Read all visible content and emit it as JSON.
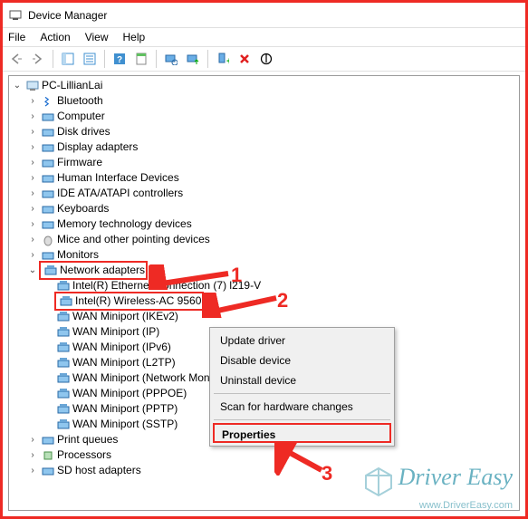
{
  "title": "Device Manager",
  "menu": {
    "file": "File",
    "action": "Action",
    "view": "View",
    "help": "Help"
  },
  "root": "PC-LillianLai",
  "nodes": [
    {
      "label": "Bluetooth",
      "icon": "bt"
    },
    {
      "label": "Computer",
      "icon": "pc"
    },
    {
      "label": "Disk drives",
      "icon": "disk"
    },
    {
      "label": "Display adapters",
      "icon": "disp"
    },
    {
      "label": "Firmware",
      "icon": "fw"
    },
    {
      "label": "Human Interface Devices",
      "icon": "hid"
    },
    {
      "label": "IDE ATA/ATAPI controllers",
      "icon": "ide"
    },
    {
      "label": "Keyboards",
      "icon": "kb"
    },
    {
      "label": "Memory technology devices",
      "icon": "mem"
    },
    {
      "label": "Mice and other pointing devices",
      "icon": "mouse"
    },
    {
      "label": "Monitors",
      "icon": "mon"
    }
  ],
  "net_label": "Network adapters",
  "net_children": [
    "Intel(R) Ethernet Connection (7) l219-V",
    "Intel(R) Wireless-AC 9560",
    "WAN Miniport (IKEv2)",
    "WAN Miniport (IP)",
    "WAN Miniport (IPv6)",
    "WAN Miniport (L2TP)",
    "WAN Miniport (Network Monitor)",
    "WAN Miniport (PPPOE)",
    "WAN Miniport (PPTP)",
    "WAN Miniport (SSTP)"
  ],
  "tail": [
    {
      "label": "Print queues",
      "icon": "print"
    },
    {
      "label": "Processors",
      "icon": "cpu"
    },
    {
      "label": "SD host adapters",
      "icon": "sd"
    }
  ],
  "ctx": {
    "update": "Update driver",
    "disable": "Disable device",
    "uninstall": "Uninstall device",
    "scan": "Scan for hardware changes",
    "props": "Properties"
  },
  "annot": {
    "n1": "1",
    "n2": "2",
    "n3": "3"
  },
  "wm": {
    "brand": "Driver Easy",
    "url": "www.DriverEasy.com"
  }
}
